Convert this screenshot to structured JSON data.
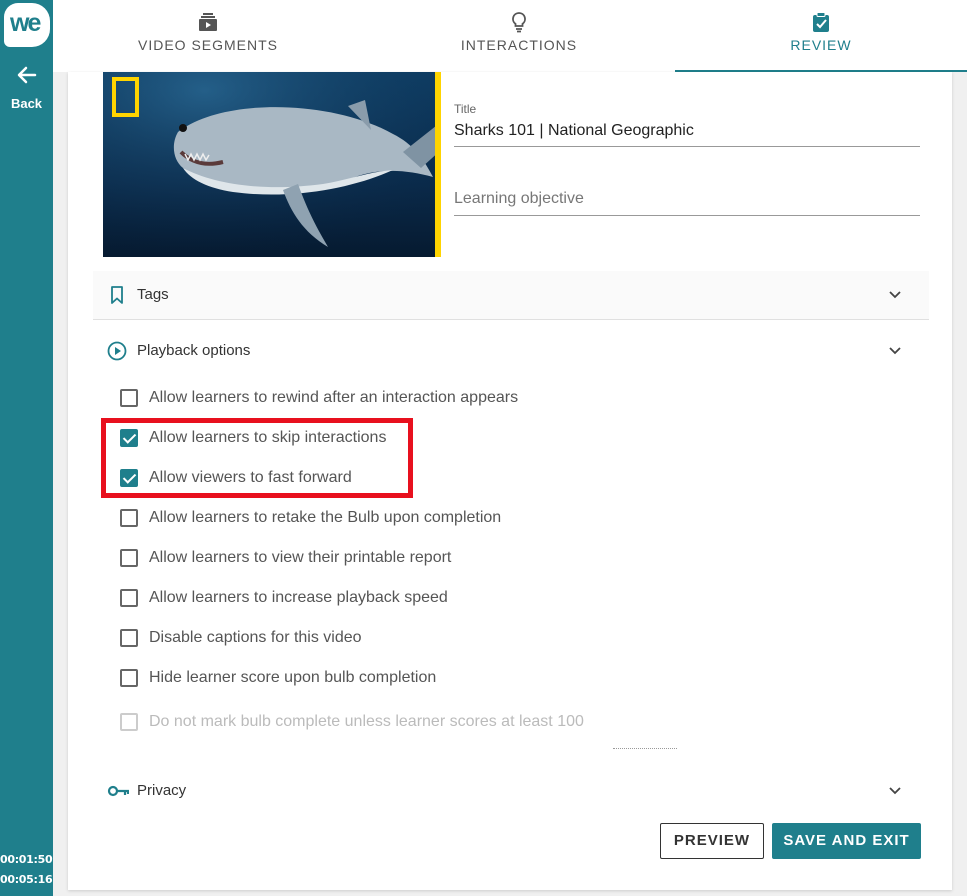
{
  "app": {
    "logo_text": "we",
    "back_label": "Back"
  },
  "timer": {
    "current": "00:01:50",
    "total": "00:05:16"
  },
  "tabs": [
    {
      "label": "VIDEO SEGMENTS",
      "icon": "video-segments-icon",
      "active": false
    },
    {
      "label": "INTERACTIONS",
      "icon": "lightbulb-icon",
      "active": false
    },
    {
      "label": "REVIEW",
      "icon": "clipboard-check-icon",
      "active": true
    }
  ],
  "details": {
    "title_label": "Title",
    "title_value": "Sharks 101 | National Geographic",
    "objective_placeholder": "Learning objective"
  },
  "sections": {
    "tags": {
      "label": "Tags",
      "icon": "bookmark-icon",
      "expanded": false
    },
    "playback": {
      "label": "Playback options",
      "icon": "play-circle-icon",
      "expanded": true
    },
    "privacy": {
      "label": "Privacy",
      "icon": "key-icon",
      "expanded": false
    }
  },
  "playback_options": [
    {
      "label": "Allow learners to rewind after an interaction appears",
      "checked": false,
      "disabled": false
    },
    {
      "label": "Allow learners to skip interactions",
      "checked": true,
      "disabled": false
    },
    {
      "label": "Allow viewers to fast forward",
      "checked": true,
      "disabled": false
    },
    {
      "label": "Allow learners to retake the Bulb upon completion",
      "checked": false,
      "disabled": false
    },
    {
      "label": "Allow learners to view their printable report",
      "checked": false,
      "disabled": false
    },
    {
      "label": "Allow learners to increase playback speed",
      "checked": false,
      "disabled": false
    },
    {
      "label": "Disable captions for this video",
      "checked": false,
      "disabled": false
    },
    {
      "label": "Hide learner score upon bulb completion",
      "checked": false,
      "disabled": false
    },
    {
      "label": "Do not mark bulb complete unless learner scores at least",
      "checked": false,
      "disabled": true,
      "score": "100"
    }
  ],
  "actions": {
    "preview_label": "PREVIEW",
    "save_label": "SAVE AND EXIT"
  },
  "colors": {
    "brand": "#1f7f8c",
    "highlight": "#e8101e",
    "ng_yellow": "#ffd400"
  }
}
